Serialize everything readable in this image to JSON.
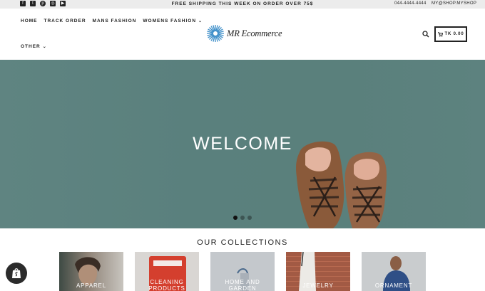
{
  "topbar": {
    "promo": "FREE SHIPPING THIS WEEK ON ORDER OVER 75$",
    "phone": "044-4444-4444",
    "email": "MY@SHOP.MYSHOP",
    "social": [
      "facebook-icon",
      "twitter-icon",
      "pinterest-icon",
      "instagram-icon",
      "youtube-icon"
    ]
  },
  "header": {
    "nav": [
      "HOME",
      "TRACK ORDER",
      "MANS FASHION",
      "WOMENS FASHION"
    ],
    "nav_more": "OTHER",
    "logo_text": "MR Ecommerce",
    "cart_label": "TK 0.00"
  },
  "hero": {
    "title": "WELCOME",
    "slides": 3,
    "active_slide": 1
  },
  "collections": {
    "title": "OUR COLLECTIONS",
    "items": [
      {
        "label": "APPAREL"
      },
      {
        "label": "CLEANING PRODUCTS"
      },
      {
        "label": "HOME AND GARDEN"
      },
      {
        "label": "JEWELRY"
      },
      {
        "label": "ORNAMENT"
      }
    ]
  },
  "colors": {
    "hero_bg": "#5a807d",
    "topbar_bg": "#ececec",
    "text": "#222222"
  }
}
